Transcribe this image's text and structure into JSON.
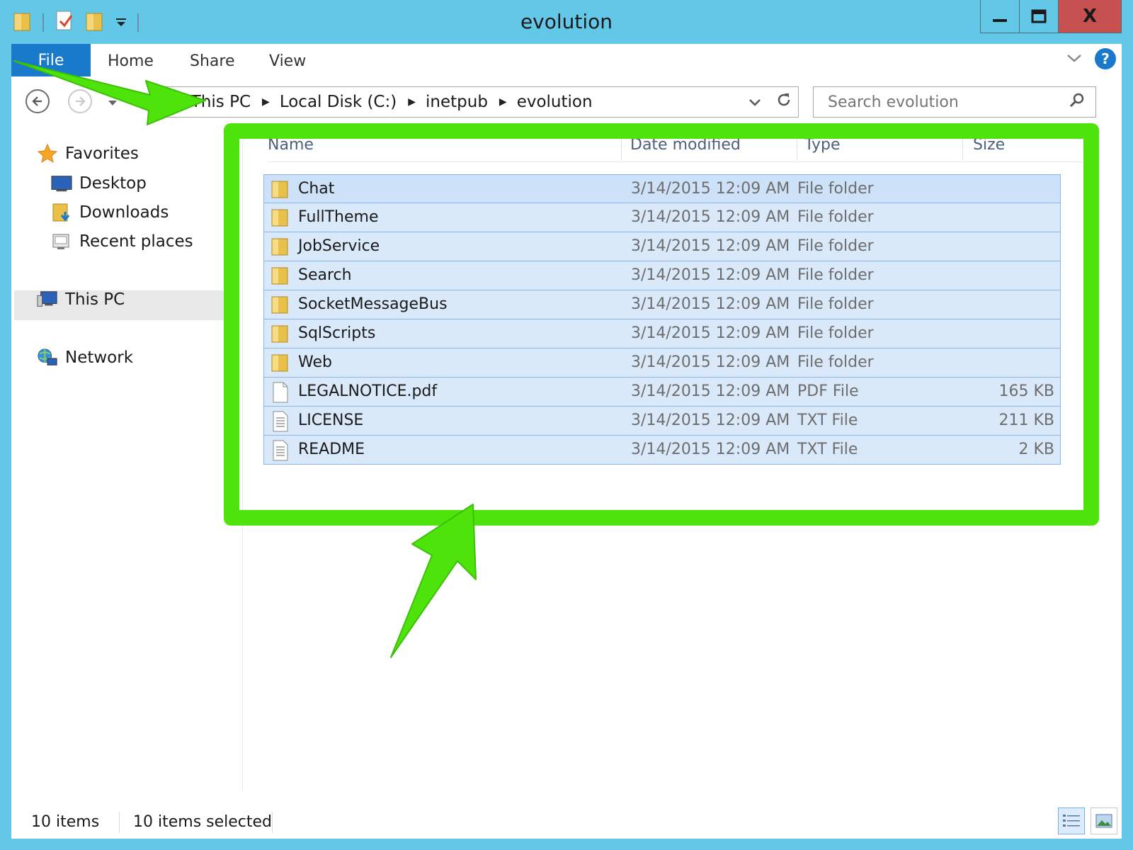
{
  "window": {
    "title": "evolution",
    "minimize_glyph": "—",
    "maximize_glyph": "□",
    "close_glyph": "X"
  },
  "ribbon": {
    "tabs": [
      {
        "label": "File"
      },
      {
        "label": "Home"
      },
      {
        "label": "Share"
      },
      {
        "label": "View"
      }
    ],
    "help_label": "?"
  },
  "address": {
    "breadcrumbs": [
      "This PC",
      "Local Disk (C:)",
      "inetpub",
      "evolution"
    ]
  },
  "search": {
    "placeholder": "Search evolution"
  },
  "navpane": {
    "favorites": {
      "label": "Favorites",
      "items": [
        {
          "label": "Desktop"
        },
        {
          "label": "Downloads"
        },
        {
          "label": "Recent places"
        }
      ]
    },
    "this_pc": {
      "label": "This PC"
    },
    "network": {
      "label": "Network"
    }
  },
  "columns": {
    "name": "Name",
    "date": "Date modified",
    "type": "Type",
    "size": "Size"
  },
  "files": [
    {
      "name": "Chat",
      "date": "3/14/2015 12:09 AM",
      "type": "File folder",
      "size": "",
      "icon": "folder-icon"
    },
    {
      "name": "FullTheme",
      "date": "3/14/2015 12:09 AM",
      "type": "File folder",
      "size": "",
      "icon": "folder-icon"
    },
    {
      "name": "JobService",
      "date": "3/14/2015 12:09 AM",
      "type": "File folder",
      "size": "",
      "icon": "folder-icon"
    },
    {
      "name": "Search",
      "date": "3/14/2015 12:09 AM",
      "type": "File folder",
      "size": "",
      "icon": "folder-icon"
    },
    {
      "name": "SocketMessageBus",
      "date": "3/14/2015 12:09 AM",
      "type": "File folder",
      "size": "",
      "icon": "folder-icon"
    },
    {
      "name": "SqlScripts",
      "date": "3/14/2015 12:09 AM",
      "type": "File folder",
      "size": "",
      "icon": "folder-icon"
    },
    {
      "name": "Web",
      "date": "3/14/2015 12:09 AM",
      "type": "File folder",
      "size": "",
      "icon": "folder-icon"
    },
    {
      "name": "LEGALNOTICE.pdf",
      "date": "3/14/2015 12:09 AM",
      "type": "PDF File",
      "size": "165 KB",
      "icon": "pdf-file-icon"
    },
    {
      "name": "LICENSE",
      "date": "3/14/2015 12:09 AM",
      "type": "TXT File",
      "size": "211 KB",
      "icon": "text-file-icon"
    },
    {
      "name": "README",
      "date": "3/14/2015 12:09 AM",
      "type": "TXT File",
      "size": "2 KB",
      "icon": "text-file-icon"
    }
  ],
  "status": {
    "item_count": "10 items",
    "selected_count": "10 items selected"
  },
  "colors": {
    "title_bar": "#63c7e8",
    "file_tab": "#1979ca",
    "selection_fill": "#d9e9fa",
    "selection_border": "#89b6e6",
    "annotation_green": "#4ee30b",
    "close_button": "#c75050"
  }
}
